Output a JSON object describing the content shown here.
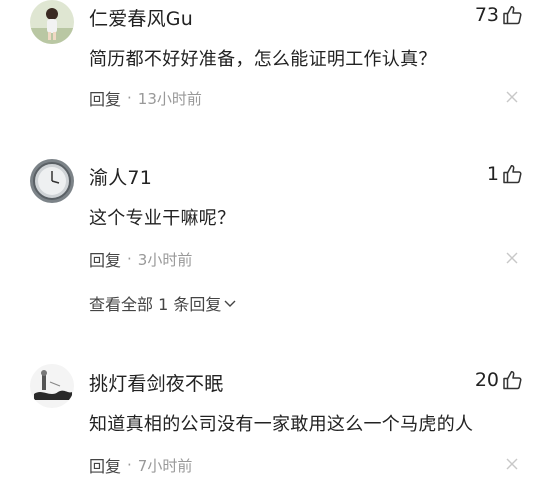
{
  "comments": [
    {
      "username": "仁爱春风Gu",
      "likes": "73",
      "text": "简历都不好好准备，怎么能证明工作认真？",
      "reply_label": "回复",
      "separator": "·",
      "time": "13小时前"
    },
    {
      "username": "渝人71",
      "likes": "1",
      "text": "这个专业干嘛呢？",
      "reply_label": "回复",
      "separator": "·",
      "time": "3小时前",
      "view_replies": "查看全部 1 条回复"
    },
    {
      "username": "挑灯看剑夜不眠",
      "likes": "20",
      "text": "知道真相的公司没有一家敢用这么一个马虎的人",
      "reply_label": "回复",
      "separator": "·",
      "time": "7小时前"
    }
  ],
  "icons": {
    "like": "thumbs-up-icon",
    "close": "close-icon",
    "expand": "chevron-down-icon"
  },
  "colors": {
    "text": "#222222",
    "muted": "#999999",
    "secondary": "#444444",
    "close": "#c8c8c8"
  }
}
